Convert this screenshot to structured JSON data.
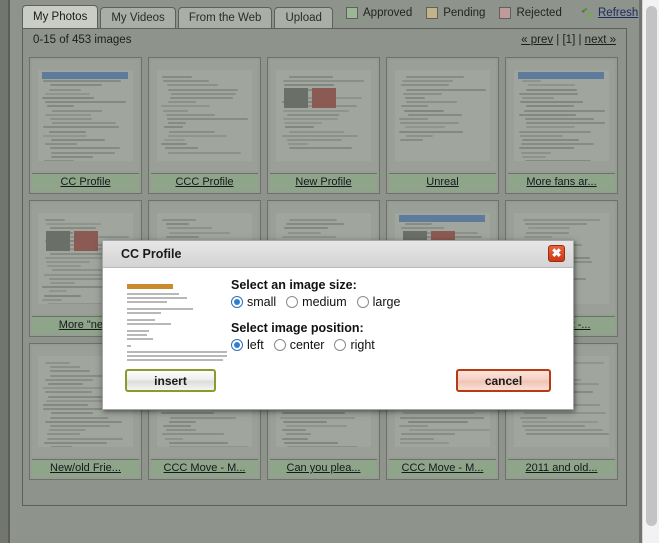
{
  "tabs": [
    {
      "label": "My Photos",
      "active": true
    },
    {
      "label": "My Videos",
      "active": false
    },
    {
      "label": "From the Web",
      "active": false
    },
    {
      "label": "Upload",
      "active": false
    }
  ],
  "legend": {
    "items": [
      {
        "label": "Approved",
        "color": "#9cb795"
      },
      {
        "label": "Pending",
        "color": "#c2b38a"
      },
      {
        "label": "Rejected",
        "color": "#bf9a9a"
      }
    ]
  },
  "refresh": {
    "label": "Refresh",
    "icon": "refresh-icon"
  },
  "panel": {
    "count_text": "0-15 of 453 images",
    "pager": {
      "prev": "« prev",
      "separator_left": " | ",
      "current": "[1]",
      "separator_right": " | ",
      "next": "next »"
    }
  },
  "grid": {
    "items": [
      {
        "caption": "CC Profile"
      },
      {
        "caption": "CCC Profile"
      },
      {
        "caption": "New Profile"
      },
      {
        "caption": "Unreal"
      },
      {
        "caption": "More fans ar..."
      },
      {
        "caption": "More \"ne..."
      },
      {
        "caption": ""
      },
      {
        "caption": ""
      },
      {
        "caption": ""
      },
      {
        "caption": "...enshot -..."
      },
      {
        "caption": "New/old Frie..."
      },
      {
        "caption": "CCC Move - M..."
      },
      {
        "caption": "Can you plea..."
      },
      {
        "caption": "CCC Move - M..."
      },
      {
        "caption": "2011 and old..."
      }
    ]
  },
  "modal": {
    "title": "CC Profile",
    "close_label": "✖",
    "size_label": "Select an image size:",
    "size_options": [
      {
        "label": "small",
        "checked": true
      },
      {
        "label": "medium",
        "checked": false
      },
      {
        "label": "large",
        "checked": false
      }
    ],
    "position_label": "Select image position:",
    "position_options": [
      {
        "label": "left",
        "checked": true
      },
      {
        "label": "center",
        "checked": false
      },
      {
        "label": "right",
        "checked": false
      }
    ],
    "insert_label": "insert",
    "cancel_label": "cancel"
  }
}
